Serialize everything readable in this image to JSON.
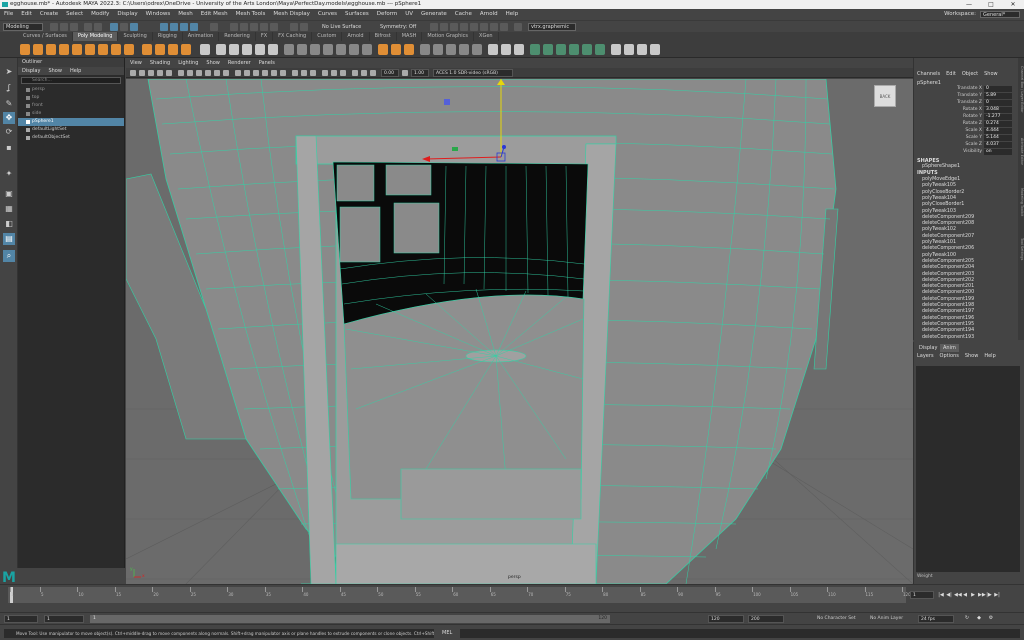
{
  "window": {
    "title": "egghouse.mb* - Autodesk MAYA 2022.3: C:\\Users\\odrex\\OneDrive - University of the Arts London\\Maya\\PerfectDay.models\\egghouse.mb  ---  pSphere1",
    "controls": [
      "—",
      "□",
      "✕"
    ]
  },
  "menubar": {
    "items": [
      "File",
      "Edit",
      "Create",
      "Select",
      "Modify",
      "Display",
      "Windows",
      "Mesh",
      "Edit Mesh",
      "Mesh Tools",
      "Mesh Display",
      "Curves",
      "Surfaces",
      "Deform",
      "UV",
      "Generate",
      "Cache",
      "Arnold",
      "Help"
    ],
    "workspace_label": "Workspace:",
    "workspace_value": "General*"
  },
  "statusline": {
    "mode": "Modeling",
    "live_surface": "No Live Surface",
    "symmetry": "Symmetry: Off",
    "cmd_field": "vtrx.graphemic"
  },
  "shelf": {
    "tabs": [
      "Curves / Surfaces",
      "Poly Modeling",
      "Sculpting",
      "Rigging",
      "Animation",
      "Rendering",
      "FX",
      "FX Caching",
      "Custom",
      "Arnold",
      "Bifrost",
      "MASH",
      "Motion Graphics",
      "XGen"
    ],
    "active_tab": "Poly Modeling"
  },
  "outliner": {
    "title": "Outliner",
    "menu": [
      "Display",
      "Show",
      "Help"
    ],
    "search_placeholder": "Search...",
    "items": [
      "persp",
      "top",
      "front",
      "side",
      "pSphere1",
      "defaultLightSet",
      "defaultObjectSet"
    ],
    "selected": "pSphere1"
  },
  "viewport": {
    "menu": [
      "View",
      "Shading",
      "Lighting",
      "Show",
      "Renderer",
      "Panels"
    ],
    "field_1": "0.00",
    "field_2": "1.00",
    "colorspace": "ACES 1.0 SDR-video (sRGB)",
    "camera_label": "persp",
    "viewcube_label": "BACK",
    "axis_x": "x",
    "axis_y": "y"
  },
  "channelbox": {
    "menu": [
      "Channels",
      "Edit",
      "Object",
      "Show"
    ],
    "object_name": "pSphere1",
    "channels": [
      {
        "label": "Translate X",
        "value": "0"
      },
      {
        "label": "Translate Y",
        "value": "5.89"
      },
      {
        "label": "Translate Z",
        "value": "0"
      },
      {
        "label": "Rotate X",
        "value": "3.048"
      },
      {
        "label": "Rotate Y",
        "value": "-1.277"
      },
      {
        "label": "Rotate Z",
        "value": "0.274"
      },
      {
        "label": "Scale X",
        "value": "4.444"
      },
      {
        "label": "Scale Y",
        "value": "5.144"
      },
      {
        "label": "Scale Z",
        "value": "4.037"
      },
      {
        "label": "Visibility",
        "value": "on"
      }
    ],
    "shapes_header": "SHAPES",
    "shape_name": "pSphereShape1",
    "inputs_header": "INPUTS",
    "inputs": [
      "polyMoveEdge1",
      "polyTweak105",
      "polyCloseBorder2",
      "polyTweak104",
      "polyCloseBorder1",
      "polyTweak103",
      "deleteComponent209",
      "deleteComponent208",
      "polyTweak102",
      "deleteComponent207",
      "polyTweak101",
      "deleteComponent206",
      "polyTweak100",
      "deleteComponent205",
      "deleteComponent204",
      "deleteComponent203",
      "deleteComponent202",
      "deleteComponent201",
      "deleteComponent200",
      "deleteComponent199",
      "deleteComponent198",
      "deleteComponent197",
      "deleteComponent196",
      "deleteComponent195",
      "deleteComponent194",
      "deleteComponent193"
    ],
    "side_tabs": [
      "Channel Box / Layer Editor",
      "Attribute Editor",
      "Modeling Toolkit",
      "Tool Settings"
    ]
  },
  "layereditor": {
    "tabs": [
      "Display",
      "Anim"
    ],
    "active_tab": "Anim",
    "menu": [
      "Layers",
      "Options",
      "Show",
      "Help"
    ],
    "footer": "Weight"
  },
  "timeline": {
    "ticks": [
      "1",
      "5",
      "10",
      "15",
      "20",
      "25",
      "30",
      "35",
      "40",
      "45",
      "50",
      "55",
      "60",
      "65",
      "70",
      "75",
      "80",
      "85",
      "90",
      "95",
      "100",
      "105",
      "110",
      "115",
      "120"
    ],
    "current_frame": "1"
  },
  "range": {
    "start": "1",
    "start_inner": "1",
    "inner_mid": "1",
    "end_inner": "120",
    "end": "120",
    "end_outer": "200",
    "character_set": "No Character Set",
    "anim_layer": "No Anim Layer",
    "fps": "24 fps"
  },
  "commandline": {
    "help": "Move Tool: Use manipulator to move object(s). Ctrl+middle-drag to move components along normals. Shift+drag manipulator axis or plane handles to extrude components or clone objects. Ctrl+Shift+drag to constrain movement to a cor",
    "mel": "MEL"
  },
  "colors": {
    "wireframe": "#31d3a6",
    "selection": "#5285a6",
    "shelf_icon": "#e08e35",
    "logo": "#1aa3a3"
  }
}
